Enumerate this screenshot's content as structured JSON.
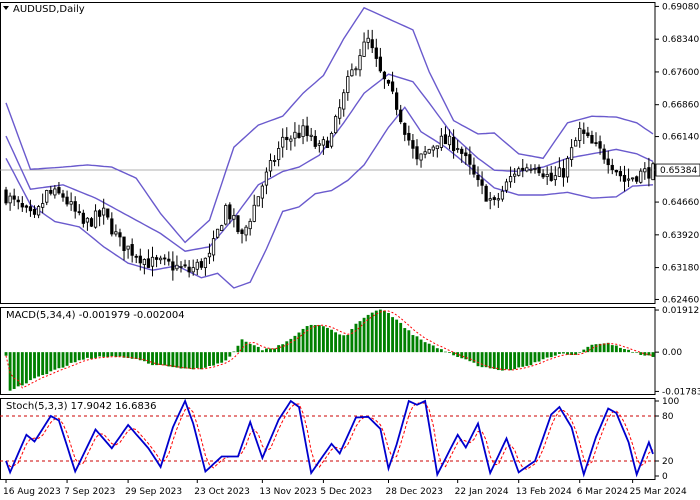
{
  "chart_data": [
    {
      "type": "candlestick",
      "panel": "price",
      "title": "AUDUSD,Daily",
      "y_ticks": [
        "0.69080",
        "0.68340",
        "0.67600",
        "0.66860",
        "0.66140",
        "0.65384",
        "0.64660",
        "0.63920",
        "0.63180",
        "0.62460"
      ],
      "current_price_label": "0.65384",
      "current_price": 0.65384,
      "ylim": [
        0.6238,
        0.6918
      ],
      "candle_count": 160,
      "candle_color": "#000000",
      "indicator": {
        "name": "Bollinger Bands",
        "color": "#6a5acd"
      },
      "close_anchors": [
        [
          0,
          0.648
        ],
        [
          7,
          0.6425
        ],
        [
          10,
          0.6485
        ],
        [
          14,
          0.648
        ],
        [
          19,
          0.6415
        ],
        [
          24,
          0.644
        ],
        [
          28,
          0.6375
        ],
        [
          35,
          0.633
        ],
        [
          40,
          0.6325
        ],
        [
          45,
          0.631
        ],
        [
          50,
          0.634
        ],
        [
          54,
          0.6455
        ],
        [
          58,
          0.6385
        ],
        [
          63,
          0.6505
        ],
        [
          68,
          0.6605
        ],
        [
          73,
          0.6625
        ],
        [
          77,
          0.6585
        ],
        [
          80,
          0.6615
        ],
        [
          84,
          0.6735
        ],
        [
          87,
          0.6805
        ],
        [
          89,
          0.683
        ],
        [
          92,
          0.6755
        ],
        [
          96,
          0.6685
        ],
        [
          101,
          0.6555
        ],
        [
          106,
          0.6605
        ],
        [
          111,
          0.6595
        ],
        [
          116,
          0.6505
        ],
        [
          120,
          0.646
        ],
        [
          125,
          0.6535
        ],
        [
          130,
          0.6555
        ],
        [
          134,
          0.6515
        ],
        [
          137,
          0.6535
        ],
        [
          141,
          0.6625
        ],
        [
          144,
          0.6595
        ],
        [
          148,
          0.6565
        ],
        [
          152,
          0.6515
        ],
        [
          155,
          0.6528
        ],
        [
          159,
          0.6538
        ]
      ],
      "bb_upper_anchors": [
        [
          0,
          0.669
        ],
        [
          6,
          0.654
        ],
        [
          14,
          0.6545
        ],
        [
          20,
          0.655
        ],
        [
          26,
          0.6545
        ],
        [
          32,
          0.652
        ],
        [
          38,
          0.644
        ],
        [
          44,
          0.6375
        ],
        [
          50,
          0.6425
        ],
        [
          56,
          0.659
        ],
        [
          62,
          0.664
        ],
        [
          68,
          0.666
        ],
        [
          73,
          0.6712
        ],
        [
          78,
          0.6752
        ],
        [
          83,
          0.6835
        ],
        [
          88,
          0.6905
        ],
        [
          94,
          0.688
        ],
        [
          100,
          0.6855
        ],
        [
          104,
          0.676
        ],
        [
          110,
          0.665
        ],
        [
          116,
          0.662
        ],
        [
          120,
          0.6622
        ],
        [
          126,
          0.6575
        ],
        [
          132,
          0.6565
        ],
        [
          138,
          0.6645
        ],
        [
          144,
          0.666
        ],
        [
          150,
          0.6658
        ],
        [
          155,
          0.6645
        ],
        [
          159,
          0.662
        ]
      ],
      "bb_middle_anchors": [
        [
          0,
          0.6615
        ],
        [
          6,
          0.6495
        ],
        [
          14,
          0.6505
        ],
        [
          22,
          0.6475
        ],
        [
          30,
          0.6435
        ],
        [
          38,
          0.6395
        ],
        [
          44,
          0.6355
        ],
        [
          50,
          0.6365
        ],
        [
          56,
          0.643
        ],
        [
          62,
          0.6505
        ],
        [
          68,
          0.6535
        ],
        [
          72,
          0.6545
        ],
        [
          77,
          0.6572
        ],
        [
          83,
          0.6645
        ],
        [
          88,
          0.6712
        ],
        [
          94,
          0.6755
        ],
        [
          100,
          0.6738
        ],
        [
          104,
          0.669
        ],
        [
          110,
          0.6615
        ],
        [
          116,
          0.6565
        ],
        [
          120,
          0.6538
        ],
        [
          126,
          0.6535
        ],
        [
          132,
          0.6545
        ],
        [
          138,
          0.6565
        ],
        [
          144,
          0.6575
        ],
        [
          150,
          0.6585
        ],
        [
          155,
          0.6575
        ],
        [
          159,
          0.6558
        ]
      ],
      "bb_lower_anchors": [
        [
          0,
          0.6565
        ],
        [
          6,
          0.646
        ],
        [
          12,
          0.6422
        ],
        [
          18,
          0.641
        ],
        [
          24,
          0.6365
        ],
        [
          30,
          0.6328
        ],
        [
          36,
          0.6312
        ],
        [
          42,
          0.6322
        ],
        [
          48,
          0.6295
        ],
        [
          52,
          0.6305
        ],
        [
          56,
          0.6272
        ],
        [
          60,
          0.6285
        ],
        [
          64,
          0.636
        ],
        [
          68,
          0.6445
        ],
        [
          72,
          0.6455
        ],
        [
          76,
          0.6485
        ],
        [
          80,
          0.6492
        ],
        [
          84,
          0.6515
        ],
        [
          88,
          0.655
        ],
        [
          94,
          0.6635
        ],
        [
          98,
          0.668
        ],
        [
          102,
          0.6625
        ],
        [
          108,
          0.659
        ],
        [
          114,
          0.6545
        ],
        [
          120,
          0.6498
        ],
        [
          126,
          0.6482
        ],
        [
          132,
          0.6482
        ],
        [
          138,
          0.6488
        ],
        [
          144,
          0.6475
        ],
        [
          150,
          0.6478
        ],
        [
          154,
          0.6502
        ],
        [
          159,
          0.6505
        ]
      ]
    },
    {
      "type": "bar",
      "panel": "macd",
      "title": "MACD(5,34,4) -0.001979 -0.002004",
      "y_ticks": [
        "0.019121",
        "0.00",
        "-0.017832"
      ],
      "ylim": [
        -0.019,
        0.0205
      ],
      "bar_color": "#008000",
      "signal_color": "#ff0000",
      "hist_anchors": [
        [
          0,
          -0.0012
        ],
        [
          1,
          -0.0175
        ],
        [
          6,
          -0.013
        ],
        [
          12,
          -0.0082
        ],
        [
          18,
          -0.0035
        ],
        [
          24,
          -0.0018
        ],
        [
          30,
          -0.0025
        ],
        [
          36,
          -0.0055
        ],
        [
          42,
          -0.0072
        ],
        [
          48,
          -0.0075
        ],
        [
          54,
          -0.004
        ],
        [
          56,
          0.0005
        ],
        [
          58,
          0.006
        ],
        [
          60,
          0.004
        ],
        [
          63,
          0.0012
        ],
        [
          66,
          0.002
        ],
        [
          70,
          0.006
        ],
        [
          74,
          0.0122
        ],
        [
          78,
          0.0118
        ],
        [
          82,
          0.0082
        ],
        [
          84,
          0.0078
        ],
        [
          86,
          0.0125
        ],
        [
          88,
          0.0152
        ],
        [
          90,
          0.018
        ],
        [
          92,
          0.0192
        ],
        [
          94,
          0.018
        ],
        [
          96,
          0.0145
        ],
        [
          100,
          0.008
        ],
        [
          104,
          0.0035
        ],
        [
          108,
          0.0005
        ],
        [
          112,
          -0.0028
        ],
        [
          116,
          -0.006
        ],
        [
          120,
          -0.0078
        ],
        [
          124,
          -0.0082
        ],
        [
          128,
          -0.0062
        ],
        [
          132,
          -0.0035
        ],
        [
          136,
          -0.0008
        ],
        [
          140,
          -0.001
        ],
        [
          144,
          0.0032
        ],
        [
          148,
          0.004
        ],
        [
          152,
          0.0015
        ],
        [
          156,
          -0.0012
        ],
        [
          159,
          -0.002
        ]
      ]
    },
    {
      "type": "line",
      "panel": "stochastic",
      "title": "Stoch(5,3,3) 17.9042 16.6836",
      "y_ticks": [
        "100",
        "80",
        "20",
        "0"
      ],
      "ylim": [
        -4,
        104
      ],
      "levels": [
        80,
        20
      ],
      "main_color": "#0000cd",
      "signal_color": "#ff0000",
      "series_anchors": [
        [
          0,
          20
        ],
        [
          1,
          5
        ],
        [
          5,
          55
        ],
        [
          7,
          46
        ],
        [
          11,
          80
        ],
        [
          13,
          74
        ],
        [
          17,
          6
        ],
        [
          22,
          62
        ],
        [
          26,
          37
        ],
        [
          30,
          68
        ],
        [
          35,
          37
        ],
        [
          38,
          12
        ],
        [
          41,
          65
        ],
        [
          44,
          100
        ],
        [
          46,
          70
        ],
        [
          49,
          6
        ],
        [
          53,
          26
        ],
        [
          57,
          26
        ],
        [
          60,
          72
        ],
        [
          63,
          24
        ],
        [
          67,
          75
        ],
        [
          70,
          100
        ],
        [
          72,
          92
        ],
        [
          75,
          4
        ],
        [
          80,
          43
        ],
        [
          82,
          30
        ],
        [
          86,
          78
        ],
        [
          89,
          79
        ],
        [
          92,
          63
        ],
        [
          94,
          10
        ],
        [
          96,
          42
        ],
        [
          99,
          100
        ],
        [
          101,
          95
        ],
        [
          103,
          100
        ],
        [
          106,
          2
        ],
        [
          111,
          55
        ],
        [
          113,
          38
        ],
        [
          116,
          70
        ],
        [
          119,
          4
        ],
        [
          123,
          50
        ],
        [
          126,
          5
        ],
        [
          130,
          20
        ],
        [
          134,
          82
        ],
        [
          136,
          92
        ],
        [
          139,
          65
        ],
        [
          142,
          2
        ],
        [
          145,
          52
        ],
        [
          148,
          90
        ],
        [
          150,
          84
        ],
        [
          153,
          45
        ],
        [
          155,
          2
        ],
        [
          158,
          45
        ],
        [
          160,
          14
        ]
      ]
    }
  ],
  "x_axis": {
    "labels": [
      "16 Aug 2023",
      "7 Sep 2023",
      "29 Sep 2023",
      "23 Oct 2023",
      "13 Nov 2023",
      "5 Dec 2023",
      "28 Dec 2023",
      "22 Jan 2024",
      "13 Feb 2024",
      "6 Mar 2024",
      "25 Mar 2024"
    ],
    "label_bars": [
      0,
      15,
      30,
      47,
      63,
      78,
      94,
      111,
      126,
      141,
      154
    ]
  },
  "colors": {
    "background": "#ffffff",
    "grid": "#999999",
    "level_line": "#cc0000"
  }
}
